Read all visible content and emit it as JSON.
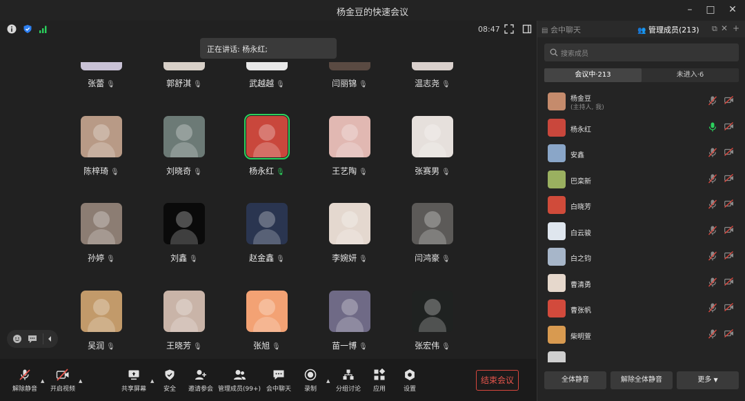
{
  "window": {
    "title": "杨金豆的快速会议"
  },
  "status": {
    "time": "08:47"
  },
  "speaking": {
    "label": "正在讲话: 杨永红;"
  },
  "grid": {
    "partial_names": [
      "张蕾",
      "郭舒淇",
      "武越越",
      "闫丽锦",
      "温志尧"
    ],
    "rows": [
      [
        {
          "name": "陈梓琦",
          "mic": "muted",
          "bg": "#b89a86"
        },
        {
          "name": "刘晓奇",
          "mic": "muted",
          "bg": "#6c7a76"
        },
        {
          "name": "杨永红",
          "mic": "on",
          "bg": "#c9473c",
          "active": true
        },
        {
          "name": "王艺陶",
          "mic": "muted",
          "bg": "#e1b8b2"
        },
        {
          "name": "张赛男",
          "mic": "muted",
          "bg": "#e6e0dc"
        }
      ],
      [
        {
          "name": "孙婷",
          "mic": "muted",
          "bg": "#8c7d73"
        },
        {
          "name": "刘鑫",
          "mic": "muted",
          "bg": "#0a0a0a"
        },
        {
          "name": "赵金鑫",
          "mic": "muted",
          "bg": "#2a3550"
        },
        {
          "name": "李婉妍",
          "mic": "muted",
          "bg": "#e4d8cf"
        },
        {
          "name": "闫鸿豪",
          "mic": "muted",
          "bg": "#5c5a58"
        }
      ],
      [
        {
          "name": "吴润",
          "mic": "muted",
          "bg": "#c29a6a"
        },
        {
          "name": "王晓芳",
          "mic": "muted",
          "bg": "#c9b4a8"
        },
        {
          "name": "张旭",
          "mic": "muted",
          "bg": "#f3a274"
        },
        {
          "name": "苗一博",
          "mic": "muted",
          "bg": "#6f6a86"
        },
        {
          "name": "张宏伟",
          "mic": "muted",
          "bg": "#1f2221"
        }
      ]
    ]
  },
  "toolbar": {
    "unmute": "解除静音",
    "start_video": "开启视频",
    "share": "共享屏幕",
    "security": "安全",
    "invite": "邀请参会",
    "manage": "管理成员(99+)",
    "chat": "会中聊天",
    "record": "录制",
    "breakout": "分组讨论",
    "apps": "应用",
    "settings": "设置",
    "end": "结束会议"
  },
  "sidebar": {
    "tab_chat": "会中聊天",
    "tab_members": "管理成员(213)",
    "search_placeholder": "搜索成员",
    "seg_in": "会议中·213",
    "seg_out": "未进入·6",
    "members": [
      {
        "name": "杨金豆",
        "sub": "(主持人, 我)",
        "mic": "muted",
        "bg": "#c58b6c"
      },
      {
        "name": "杨永红",
        "sub": "",
        "mic": "on",
        "bg": "#c9473c"
      },
      {
        "name": "安鑫",
        "sub": "",
        "mic": "muted",
        "bg": "#8aa6c8"
      },
      {
        "name": "巴栾新",
        "sub": "",
        "mic": "muted",
        "bg": "#9ab060"
      },
      {
        "name": "白晓芳",
        "sub": "",
        "mic": "muted",
        "bg": "#d04b3a"
      },
      {
        "name": "白云骏",
        "sub": "",
        "mic": "muted",
        "bg": "#dfe6ee"
      },
      {
        "name": "白之钧",
        "sub": "",
        "mic": "muted",
        "bg": "#a7b6c9"
      },
      {
        "name": "曹清勇",
        "sub": "",
        "mic": "muted",
        "bg": "#e6d8cc"
      },
      {
        "name": "曹张帆",
        "sub": "",
        "mic": "muted",
        "bg": "#d24a3c"
      },
      {
        "name": "柴明萱",
        "sub": "",
        "mic": "muted",
        "bg": "#d89a50"
      }
    ],
    "mute_all": "全体静音",
    "unmute_all": "解除全体静音",
    "more": "更多"
  },
  "colors": {
    "accent_green": "#2bd15d",
    "danger": "#e5554c",
    "bg": "#212121"
  }
}
